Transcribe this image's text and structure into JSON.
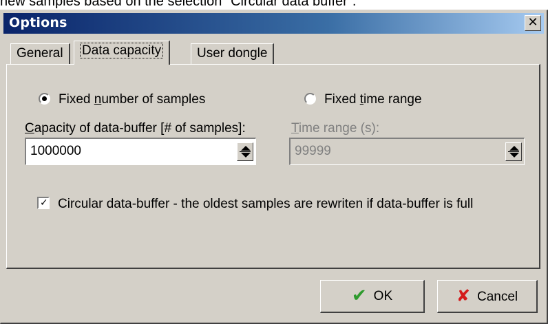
{
  "above_text": "new samples based on the selection \"Circular data buffer\".",
  "window": {
    "title": "Options",
    "close_glyph": "✕"
  },
  "tabs": [
    {
      "label": "General"
    },
    {
      "label": "Data capacity",
      "active": true
    },
    {
      "label": "User dongle"
    }
  ],
  "capacity": {
    "radio_fixed_samples": {
      "prefix": "Fixed ",
      "accel": "n",
      "rest": "umber of samples",
      "checked": true
    },
    "radio_fixed_time": {
      "prefix": "Fixed ",
      "accel": "t",
      "rest": "ime range",
      "checked": false
    },
    "capacity_label": {
      "accel": "C",
      "rest": "apacity of data-buffer [# of samples]:"
    },
    "capacity_value": "1000000",
    "time_label": {
      "accel": "T",
      "rest": "ime range (s):"
    },
    "time_value": "99999",
    "circular_label": "Circular data-buffer - the oldest samples are rewriten if data-buffer is full",
    "circular_checked": true
  },
  "buttons": {
    "ok": "OK",
    "cancel": "Cancel"
  },
  "icons": {
    "ok": "checkmark-icon",
    "cancel": "x-icon",
    "spin": "spin-arrows-icon",
    "close": "close-icon",
    "check": "✓"
  },
  "colors": {
    "title_gradient_start": "#0a246a",
    "title_gradient_end": "#a6caf0",
    "face": "#d4d0c8",
    "ok_icon": "#2d9a2d",
    "cancel_icon": "#d41a1a"
  }
}
